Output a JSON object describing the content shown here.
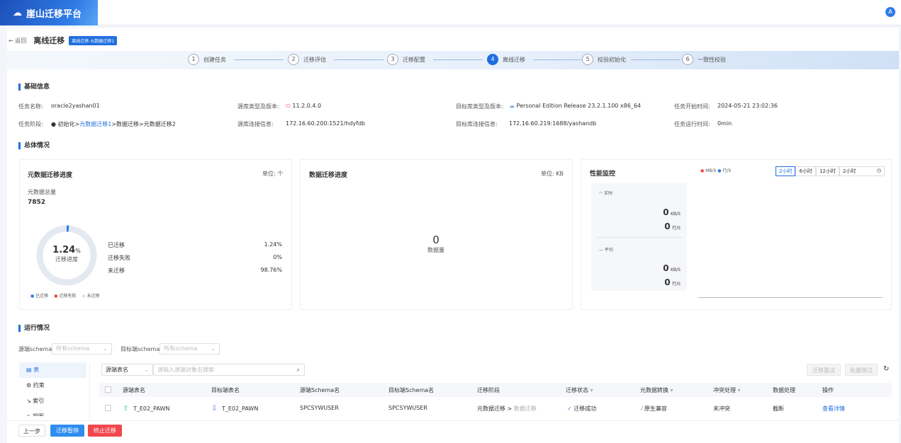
{
  "app": {
    "title": "崖山迁移平台",
    "avatar": "A"
  },
  "header": {
    "back": "返回",
    "title": "离线迁移",
    "tag": "离线迁移-元数据迁移1"
  },
  "steps": [
    {
      "n": "1",
      "label": "创建任务"
    },
    {
      "n": "2",
      "label": "迁移评估"
    },
    {
      "n": "3",
      "label": "迁移配置"
    },
    {
      "n": "4",
      "label": "离线迁移",
      "active": true
    },
    {
      "n": "5",
      "label": "校验初始化"
    },
    {
      "n": "6",
      "label": "一致性校验"
    }
  ],
  "basic": {
    "title": "基础信息",
    "task_name_label": "任务名称:",
    "task_name": "oracle2yashan01",
    "src_type_label": "源库类型及版本:",
    "src_type": "11.2.0.4.0",
    "dst_type_label": "目标库类型及版本:",
    "dst_type": "Personal Edition Release 23.2.1.100 x86_64",
    "start_label": "任务开始时间:",
    "start": "2024-05-21 23:02:36",
    "stage_label": "任务阶段:",
    "stage_pre": "初始化>",
    "stage_link": "元数据迁移1",
    "stage_post": ">数据迁移>元数据迁移2",
    "src_conn_label": "源库连接信息:",
    "src_conn": "172.16.60.200:1521/hdyfdb",
    "dst_conn_label": "目标库连接信息:",
    "dst_conn": "172.16.60.219:1688/yashandb",
    "run_label": "任务运行时间:",
    "run": "0min"
  },
  "overview": {
    "title": "总体情况",
    "meta": {
      "title": "元数据迁移进度",
      "unit": "单位: 个",
      "total_label": "元数据总量",
      "total": "7852",
      "percent": "1.24",
      "percent_sign": "%",
      "progress_label": "迁移进度",
      "progress": 1.24,
      "rows": [
        {
          "label": "已迁移",
          "value": "1.24%"
        },
        {
          "label": "迁移失败",
          "value": "0%"
        },
        {
          "label": "未迁移",
          "value": "98.76%"
        }
      ],
      "legend": [
        {
          "label": "已迁移",
          "color": "#2f7be6"
        },
        {
          "label": "迁移失败",
          "color": "#e84c4c"
        },
        {
          "label": "未迁移",
          "color": "#dde3ec"
        }
      ]
    },
    "data": {
      "title": "数据迁移进度",
      "unit": "单位: KB",
      "value": "0",
      "value_label": "数据量"
    },
    "perf": {
      "title": "性能监控",
      "legend": [
        {
          "label": "MB/S",
          "color": "#e84c4c"
        },
        {
          "label": "行/S",
          "color": "#2f7be6"
        }
      ],
      "ranges": [
        "2小时",
        "6小时",
        "12小时"
      ],
      "active_range": "2小时",
      "range_input": "2小时",
      "realtime_label": "实时",
      "avg_label": "平均",
      "rt_kb": "0",
      "rt_kb_unit": "KB/S",
      "rt_rows": "0",
      "rt_rows_unit": "行/S",
      "avg_kb": "0",
      "avg_kb_unit": "KB/S",
      "avg_rows": "0",
      "avg_rows_unit": "行/S"
    }
  },
  "run": {
    "title": "运行情况",
    "src_schema_label": "源端schema",
    "src_schema_ph": "所有schema",
    "dst_schema_label": "目标端schema",
    "dst_schema_ph": "所有schema",
    "side": [
      "表",
      "约束",
      "索引",
      "视图"
    ],
    "search_field": "源端表名",
    "search_ph": "请输入源端对象名搜索",
    "retry": "迁移重试",
    "skip": "批量跳过",
    "columns": [
      "源端表名",
      "目标端表名",
      "源端Schema名",
      "目标端Schema名",
      "迁移阶段",
      "迁移状态",
      "元数据转换",
      "冲突处理",
      "数据处理",
      "操作"
    ],
    "rows": [
      {
        "src": "T_E02_PAWN",
        "dst": "T_E02_PAWN",
        "src_schema": "SPCSYWUSER",
        "dst_schema": "SPCSYWUSER",
        "stage": "元数据迁移 >",
        "stage2": "数据迁移",
        "status": "迁移成功",
        "convert": "原生兼容",
        "conflict": "未冲突",
        "data": "截断",
        "action": "查看详情"
      }
    ]
  },
  "footer": {
    "prev": "上一步",
    "pause": "迁移暂停",
    "stop": "终止迁移"
  }
}
